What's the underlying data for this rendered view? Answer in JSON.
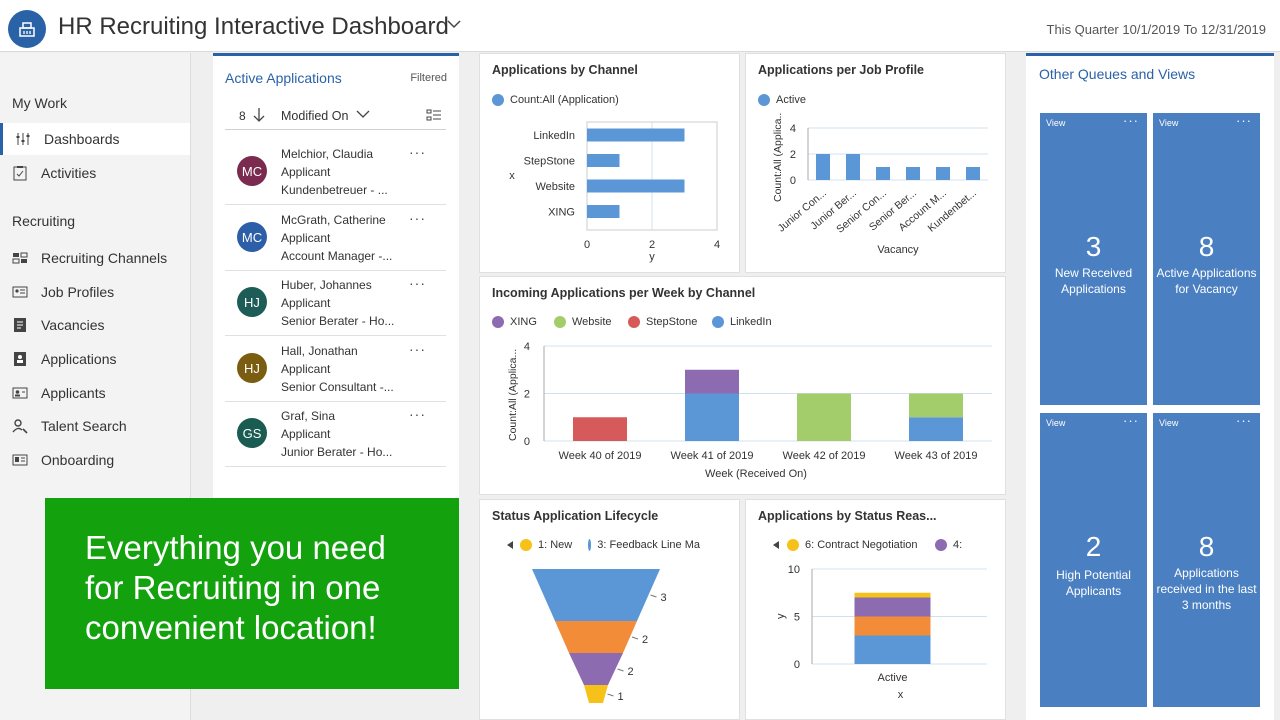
{
  "header": {
    "title": "HR Recruiting Interactive Dashboard",
    "date_range": "This Quarter 10/1/2019 To 12/31/2019"
  },
  "sidebar": {
    "my_work": "My Work",
    "work_items": [
      {
        "label": "Dashboards",
        "icon": "dashboard-icon"
      },
      {
        "label": "Activities",
        "icon": "activities-icon"
      }
    ],
    "recruiting": "Recruiting",
    "recruiting_items": [
      {
        "label": "Recruiting Channels",
        "icon": "channels-icon"
      },
      {
        "label": "Job Profiles",
        "icon": "job-profile-icon"
      },
      {
        "label": "Vacancies",
        "icon": "vacancy-icon"
      },
      {
        "label": "Applications",
        "icon": "application-icon"
      },
      {
        "label": "Applicants",
        "icon": "applicant-icon"
      },
      {
        "label": "Talent Search",
        "icon": "talent-search-icon"
      },
      {
        "label": "Onboarding",
        "icon": "onboarding-icon"
      }
    ]
  },
  "applications": {
    "title": "Active Applications",
    "filtered": "Filtered",
    "count": "8",
    "sort_label": "Modified On",
    "records": [
      {
        "initials": "MC",
        "color": "#7a2b4f",
        "name": "Melchior, Claudia",
        "role": "Applicant",
        "job": "Kundenbetreuer - ..."
      },
      {
        "initials": "MC",
        "color": "#2d5ea8",
        "name": "McGrath, Catherine",
        "role": "Applicant",
        "job": "Account Manager -..."
      },
      {
        "initials": "HJ",
        "color": "#1d5c57",
        "name": "Huber, Johannes",
        "role": "Applicant",
        "job": "Senior Berater - Ho..."
      },
      {
        "initials": "HJ",
        "color": "#7a5d10",
        "name": "Hall, Jonathan",
        "role": "Applicant",
        "job": "Senior Consultant -..."
      },
      {
        "initials": "GS",
        "color": "#1a5c52",
        "name": "Graf, Sina",
        "role": "Applicant",
        "job": "Junior Berater - Ho..."
      }
    ]
  },
  "promo": {
    "line1": "Everything you need",
    "line2": "for Recruiting in one",
    "line3": "convenient location!"
  },
  "queues": {
    "title": "Other Queues and Views",
    "view_label": "View",
    "tiles": [
      {
        "count": "3",
        "line1": "New Received",
        "line2": "Applications",
        "line3": ""
      },
      {
        "count": "8",
        "line1": "Active Applications",
        "line2": "for Vacancy",
        "line3": ""
      },
      {
        "count": "2",
        "line1": "High Potential",
        "line2": "Applicants",
        "line3": ""
      },
      {
        "count": "8",
        "line1": "Applications",
        "line2": "received in the last",
        "line3": "3 months"
      }
    ]
  },
  "colors": {
    "accent": "#2a62a8",
    "bar_blue": "#5b97d6",
    "xing": "#8c6bb1",
    "website": "#a3cc6a",
    "stepstone": "#d65a5a",
    "feedback": "#f28c38",
    "promo_green": "#13a10e",
    "tile_blue": "#4a7fc1"
  },
  "chart_data": [
    {
      "type": "bar",
      "title": "Applications by Channel",
      "orientation": "horizontal",
      "categories": [
        "LinkedIn",
        "StepStone",
        "Website",
        "XING"
      ],
      "series": [
        {
          "name": "Count:All (Application)",
          "values": [
            3,
            1,
            3,
            1
          ]
        }
      ],
      "xlabel": "y",
      "ylabel": "x",
      "xlim": [
        0,
        4
      ],
      "ticks": [
        "0",
        "2",
        "4"
      ]
    },
    {
      "type": "bar",
      "title": "Applications per Job Profile",
      "categories": [
        "Junior Con...",
        "Junior Ber...",
        "Senior Con...",
        "Senior Ber...",
        "Account M...",
        "Kundenbet..."
      ],
      "series": [
        {
          "name": "Active",
          "values": [
            2,
            2,
            1,
            1,
            1,
            1
          ]
        }
      ],
      "xlabel": "Vacancy",
      "ylabel": "Count:All (Applica...",
      "ylim": [
        0,
        4
      ],
      "ticks": [
        "0",
        "2",
        "4"
      ]
    },
    {
      "type": "bar",
      "stacked": true,
      "title": "Incoming Applications per Week by Channel",
      "categories": [
        "Week 40 of 2019",
        "Week 41 of 2019",
        "Week 42 of 2019",
        "Week 43 of 2019"
      ],
      "series": [
        {
          "name": "XING",
          "values": [
            0,
            1,
            0,
            0
          ]
        },
        {
          "name": "Website",
          "values": [
            0,
            0,
            2,
            1
          ]
        },
        {
          "name": "StepStone",
          "values": [
            1,
            0,
            0,
            0
          ]
        },
        {
          "name": "LinkedIn",
          "values": [
            0,
            2,
            0,
            1
          ]
        }
      ],
      "xlabel": "Week (Received On)",
      "ylabel": "Count:All (Applica...",
      "ylim": [
        0,
        4
      ],
      "ticks": [
        "0",
        "2",
        "4"
      ]
    },
    {
      "type": "funnel",
      "title": "Status Application Lifecycle",
      "legend": [
        "1: New",
        "3: Feedback Line Ma"
      ],
      "values": [
        3,
        2,
        2,
        1
      ],
      "labels": [
        "3",
        "2",
        "2",
        "1"
      ]
    },
    {
      "type": "bar",
      "stacked": true,
      "title": "Applications by Status Reas...",
      "categories": [
        "Active"
      ],
      "legend": [
        "6: Contract Negotiation",
        "4:"
      ],
      "segments": [
        3,
        2,
        2,
        0.5
      ],
      "xlabel": "x",
      "ylabel": "y",
      "ylim": [
        0,
        10
      ],
      "ticks": [
        "0",
        "5",
        "10"
      ]
    }
  ]
}
